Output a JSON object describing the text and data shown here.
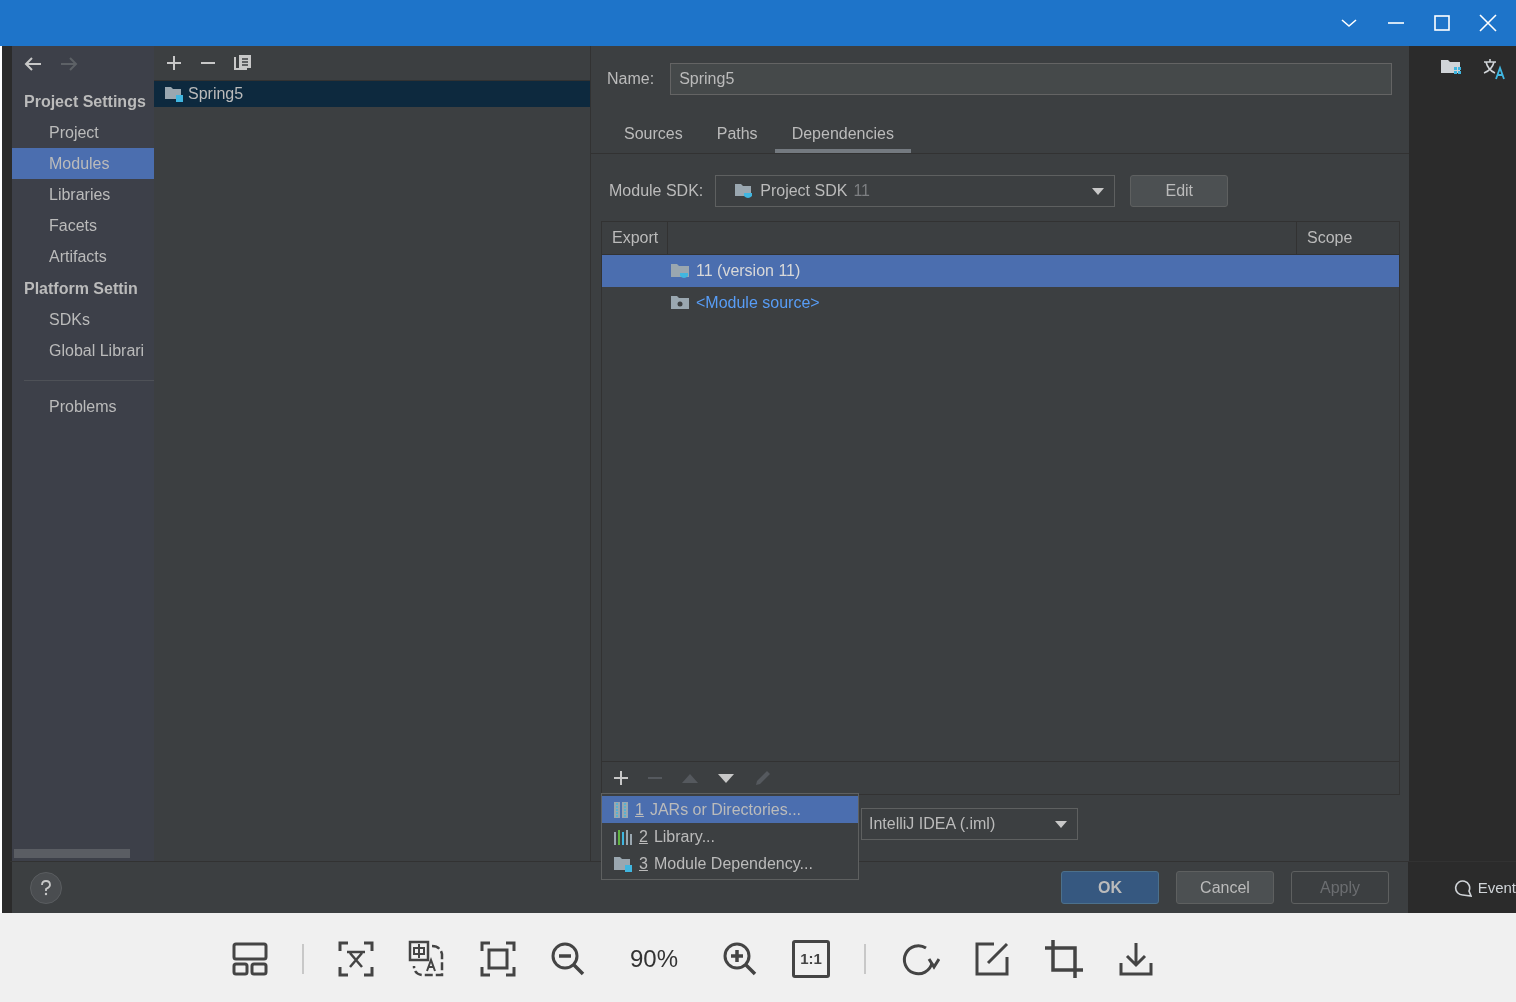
{
  "sidebar": {
    "sections": [
      {
        "title": "Project Settings",
        "items": [
          {
            "label": "Project",
            "selected": false
          },
          {
            "label": "Modules",
            "selected": true
          },
          {
            "label": "Libraries",
            "selected": false
          },
          {
            "label": "Facets",
            "selected": false
          },
          {
            "label": "Artifacts",
            "selected": false
          }
        ]
      },
      {
        "title": "Platform Settin",
        "items": [
          {
            "label": "SDKs",
            "selected": false
          },
          {
            "label": "Global Librari",
            "selected": false
          }
        ]
      }
    ],
    "problems": "Problems"
  },
  "modules": {
    "items": [
      {
        "name": "Spring5",
        "selected": true
      }
    ]
  },
  "module": {
    "name_label": "Name:",
    "name": "Spring5",
    "tabs": [
      {
        "label": "Sources",
        "selected": false
      },
      {
        "label": "Paths",
        "selected": false
      },
      {
        "label": "Dependencies",
        "selected": true
      }
    ],
    "sdk_label": "Module SDK:",
    "sdk": "Project SDK",
    "sdk_version": "11",
    "edit_button": "Edit",
    "table": {
      "columns": [
        "Export",
        "Scope"
      ],
      "rows": [
        {
          "name": "11 (version 11)",
          "kind": "sdk",
          "selected": true
        },
        {
          "name": "<Module source>",
          "kind": "source",
          "selected": false
        }
      ]
    },
    "toolbar": [
      {
        "kind": "add",
        "disabled": false
      },
      {
        "kind": "remove",
        "disabled": true
      },
      {
        "kind": "up",
        "disabled": true
      },
      {
        "kind": "down",
        "disabled": false
      },
      {
        "kind": "edit",
        "disabled": true
      }
    ],
    "storage_format": "IntelliJ IDEA (.iml)"
  },
  "popup_menu": [
    {
      "number": "1",
      "label": "JARs or Directories...",
      "kind": "jars",
      "selected": true
    },
    {
      "number": "2",
      "label": "Library...",
      "kind": "library",
      "selected": false
    },
    {
      "number": "3",
      "label": "Module Dependency...",
      "kind": "module",
      "selected": false
    }
  ],
  "buttons": [
    {
      "label": "OK",
      "default": true,
      "disabled": false
    },
    {
      "label": "Cancel",
      "default": false,
      "disabled": false
    },
    {
      "label": "Apply",
      "default": false,
      "disabled": true
    }
  ],
  "side_strip": {
    "event_label": "Event"
  },
  "viewer_toolbar": {
    "zoom": "90%",
    "actual_size": "1:1"
  }
}
